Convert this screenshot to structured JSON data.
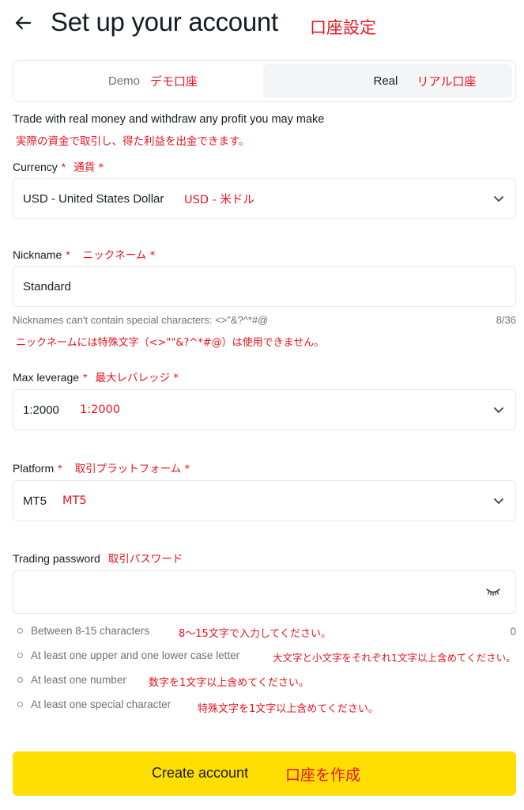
{
  "header": {
    "title": "Set up your account",
    "title_annotation": "口座設定"
  },
  "tabs": [
    {
      "label": "Demo",
      "annotation": "デモ口座"
    },
    {
      "label": "Real",
      "annotation": "リアル口座"
    }
  ],
  "description": {
    "text": "Trade with real money and withdraw any profit you may make",
    "annotation": "実際の資金で取引し、得た利益を出金できます。"
  },
  "currency": {
    "label": "Currency",
    "required_mark": "*",
    "label_annotation": "通貨 *",
    "value": "USD - United States Dollar",
    "value_annotation": "USD - 米ドル"
  },
  "nickname": {
    "label": "Nickname",
    "required_mark": "*",
    "label_annotation": "ニックネーム *",
    "value": "Standard",
    "hint": "Nicknames can't contain special characters: <>\"&?^*#@",
    "counter": "8/36",
    "hint_annotation": "ニックネームには特殊文字（<>\"\"&?^*#@）は使用できません。"
  },
  "leverage": {
    "label": "Max leverage",
    "required_mark": "*",
    "label_annotation": "最大レバレッジ *",
    "value": "1:2000",
    "value_annotation": "1:2000"
  },
  "platform": {
    "label": "Platform",
    "required_mark": "*",
    "label_annotation": "取引プラットフォーム *",
    "value": "MT5",
    "value_annotation": "MT5"
  },
  "password": {
    "label": "Trading password",
    "label_annotation": "取引パスワード",
    "value": "",
    "counter": "0",
    "rules": [
      {
        "text": "Between 8-15 characters",
        "annotation": "8～15文字で入力してください。"
      },
      {
        "text": "At least one upper and one lower case letter",
        "annotation": "大文字と小文字をそれぞれ1文字以上含めてください。"
      },
      {
        "text": "At least one number",
        "annotation": "数字を1文字以上含めてください。"
      },
      {
        "text": "At least one special character",
        "annotation": "特殊文字を1文字以上含めてください。"
      }
    ]
  },
  "submit": {
    "label": "Create account",
    "annotation": "口座を作成"
  },
  "colors": {
    "accent_yellow": "#ffde02",
    "annotation_red": "#e8141c",
    "text_dark": "#141d22",
    "text_muted": "#6b7278",
    "border": "#e6e8ea"
  }
}
